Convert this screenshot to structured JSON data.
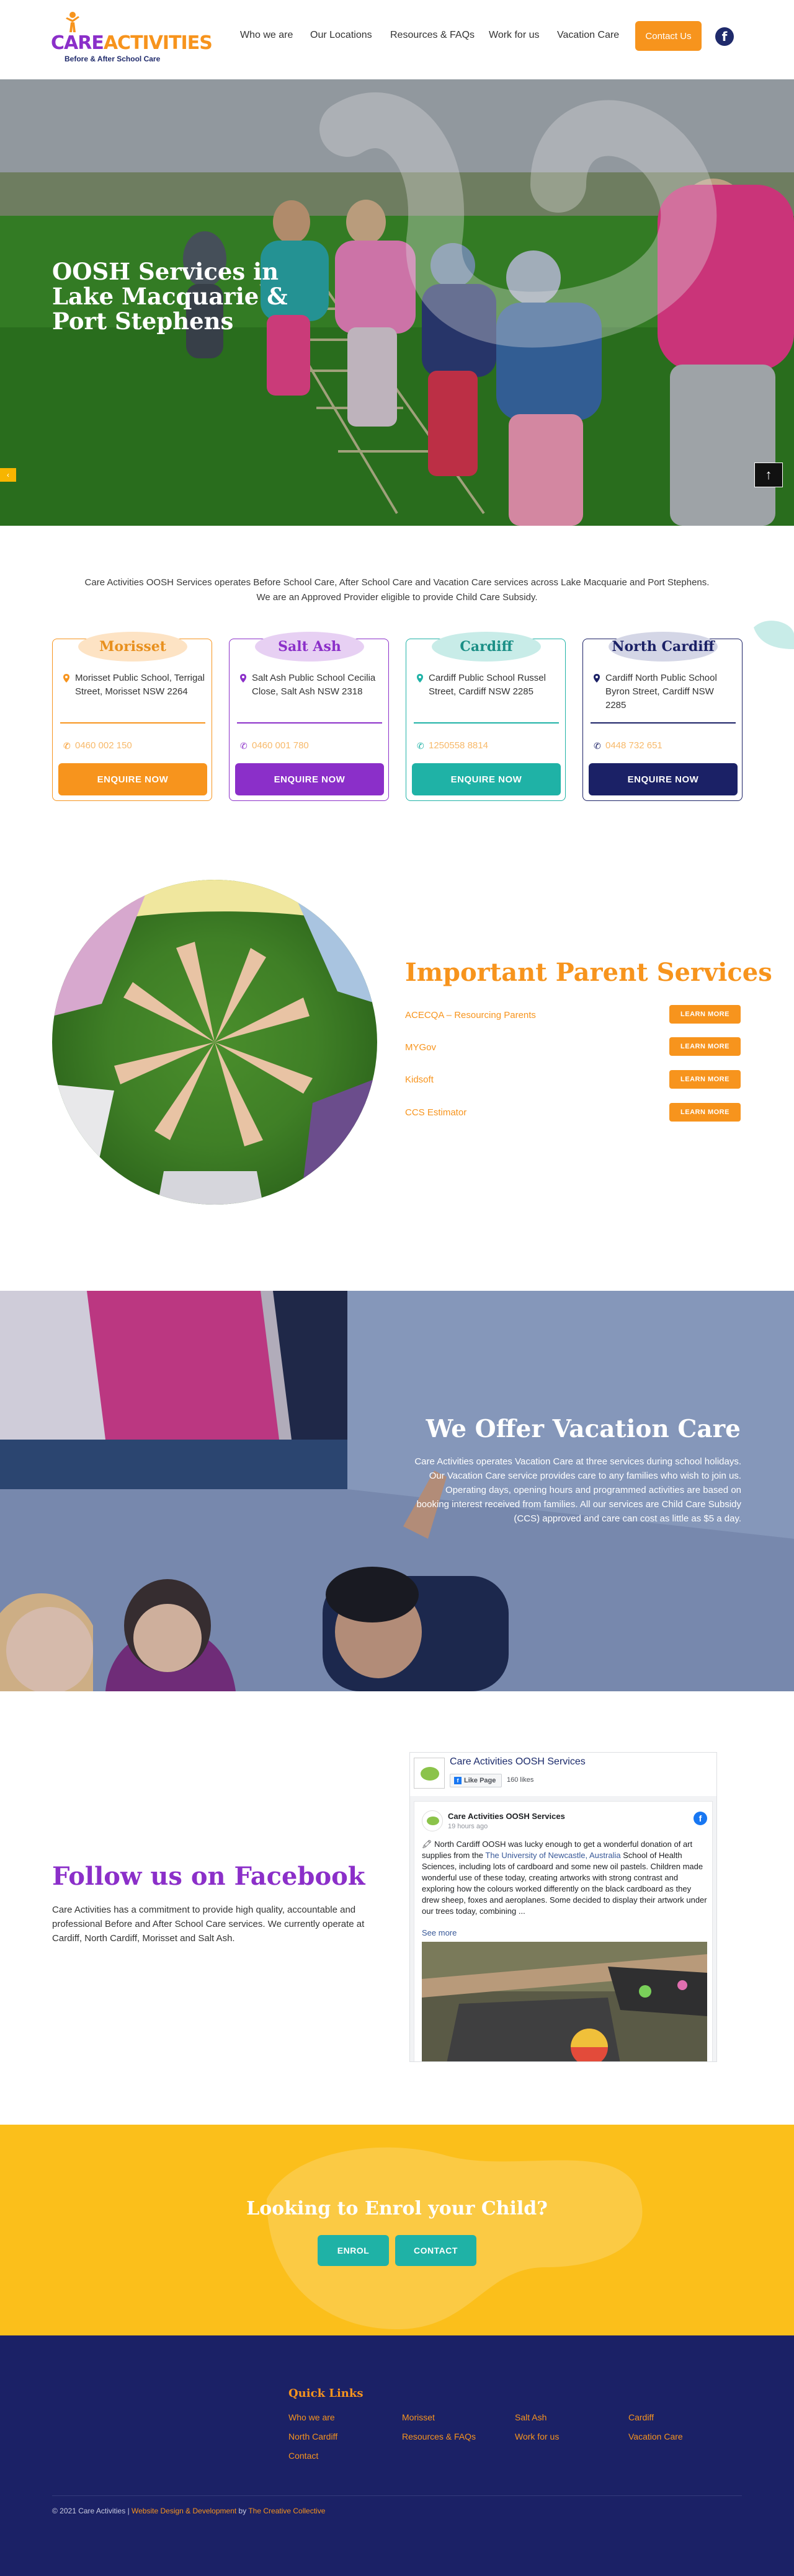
{
  "header": {
    "logo": {
      "title_care": "CARE",
      "title_activities": "ACTIVITIES",
      "subtitle": "Before & After School Care"
    },
    "nav": [
      "Who we are",
      "Our Locations",
      "Resources & FAQs",
      "Work for us",
      "Vacation Care"
    ],
    "contact_label": "Contact Us",
    "facebook_icon": "facebook-icon"
  },
  "hero": {
    "title": "OOSH Services in Lake Macquarie & Port Stephens"
  },
  "intro": {
    "line1": "Care Activities OOSH Services operates Before School Care, After School Care and Vacation Care services across Lake Macquarie and Port Stephens.",
    "line2": "We are an Approved Provider eligible to provide Child Care Subsidy."
  },
  "locations": [
    {
      "name": "Morisset",
      "address": "Morisset Public School, Terrigal Street, Morisset NSW 2264",
      "phone": "0460 002 150",
      "button": "ENQUIRE NOW",
      "accent": "#f7941d",
      "tag_bg": "#fde3c4",
      "tag_color": "#e8901e"
    },
    {
      "name": "Salt Ash",
      "address": "Salt Ash Public School Cecilia Close, Salt Ash NSW 2318",
      "phone": "0460 001 780",
      "button": "ENQUIRE NOW",
      "accent": "#8b2fc9",
      "tag_bg": "#e7d0f3",
      "tag_color": "#8b2fc9"
    },
    {
      "name": "Cardiff",
      "address": "Cardiff Public School Russel Street, Cardiff NSW 2285",
      "phone": "1250558 8814",
      "button": "ENQUIRE NOW",
      "accent": "#1fb2a6",
      "tag_bg": "#c8ece8",
      "tag_color": "#1b8f86"
    },
    {
      "name": "North Cardiff",
      "address": "Cardiff North Public School Byron Street, Cardiff NSW 2285",
      "phone": "0448 732 651",
      "button": "ENQUIRE NOW",
      "accent": "#1b2166",
      "tag_bg": "#d4d6e6",
      "tag_color": "#1b2166"
    }
  ],
  "parent_services": {
    "title": "Important Parent Services",
    "items": [
      {
        "label": "ACECQA – Resourcing Parents",
        "button": "LEARN MORE"
      },
      {
        "label": "MYGov",
        "button": "LEARN MORE"
      },
      {
        "label": "Kidsoft",
        "button": "LEARN MORE"
      },
      {
        "label": "CCS Estimator",
        "button": "LEARN MORE"
      }
    ]
  },
  "vacation": {
    "title": "We Offer Vacation Care",
    "text": "Care Activities operates Vacation Care at three services during school holidays. Our Vacation Care service provides care to any families who wish to join us. Operating days, opening hours and programmed activities are based on booking interest received from families. All our services are Child Care Subsidy (CCS) approved and care can cost as little as $5 a day."
  },
  "facebook": {
    "title": "Follow us on Facebook",
    "text": "Care Activities has a commitment to provide high quality, accountable and professional Before and After School Care services. We currently operate at Cardiff, North Cardiff, Morisset and Salt Ash.",
    "widget": {
      "page_name": "Care Activities OOSH Services",
      "like_label": "Like Page",
      "likes": "160 likes",
      "post_author": "Care Activities OOSH Services",
      "post_time": "19 hours ago",
      "post_text_1": "North Cardiff OOSH was lucky enough to get a wonderful donation of art supplies from the ",
      "post_link": "The University of Newcastle, Australia",
      "post_text_2": " School of Health Sciences, including lots of cardboard and some new oil pastels. Children made wonderful use of these today, creating artworks with strong contrast and exploring how the colours worked differently on the black cardboard as they drew sheep, foxes and aeroplanes. Some decided to display their artwork under our trees today, combining ...",
      "see_more": "See more"
    }
  },
  "enrol": {
    "title": "Looking to Enrol your Child?",
    "enrol_label": "ENROL",
    "contact_label": "CONTACT"
  },
  "footer": {
    "quick_links_title": "Quick Links",
    "links": [
      "Who we are",
      "Morisset",
      "Salt Ash",
      "Cardiff",
      "North Cardiff",
      "Resources & FAQs",
      "Work for us",
      "Vacation Care",
      "Contact"
    ],
    "copyright": "© 2021 Care Activities | ",
    "credit_link": "Website Design & Development",
    "credit_by": " by ",
    "agency": "The Creative Collective"
  },
  "colors": {
    "orange": "#f7941d",
    "purple": "#8b2fc9",
    "teal": "#1fb2a6",
    "navy": "#1b2166",
    "yellow": "#fbbf1b"
  }
}
